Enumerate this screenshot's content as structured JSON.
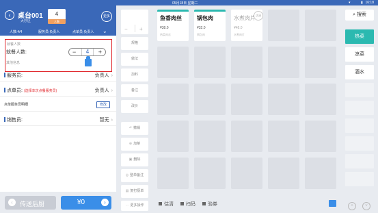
{
  "status_bar": {
    "date": "05月18日 星期二",
    "time": "16:18"
  },
  "header": {
    "table_name": "桌台001",
    "hall": "大厅区",
    "guest_count": "4",
    "guest_label": "人数",
    "more_label": "更多",
    "diners_info": "人数:4/4",
    "waiter_info": "服务员:负责人",
    "orderer_info": "点单员:负责人"
  },
  "form": {
    "diners_section": "就餐人数",
    "diners_label": "就餐人数:",
    "diners_value": "4",
    "other_info": "其他信息",
    "waiter_label": "服务员:",
    "waiter_value": "负责人",
    "orderer_label": "点单员:",
    "orderer_note": "(选择本次点餐服务员)",
    "orderer_value": "负责人",
    "per_order_label": "点单服务员明细",
    "modify_label": "修改",
    "sales_label": "销售员:",
    "sales_value": "暂无"
  },
  "footer": {
    "send_label": "传送后厨",
    "total": "¥0"
  },
  "actions": [
    "规格",
    "做法",
    "加料",
    "备注",
    "改价",
    "撤销",
    "加菜",
    "删除",
    "整单备注",
    "复打厨单",
    "更多操作"
  ],
  "dishes": [
    {
      "name": "鱼香肉丝",
      "price": "¥38.0",
      "category": "热菜肉丝",
      "available": true
    },
    {
      "name": "锅包肉",
      "price": "¥32.0",
      "category": "锅包肉",
      "available": true
    },
    {
      "name": "水煮肉片",
      "price": "¥48.0",
      "category": "水煮肉片",
      "available": false,
      "badge": "沽清"
    }
  ],
  "bottom_bar": {
    "sold_out": "估清",
    "scan": "扫码",
    "coupon": "验券"
  },
  "sidebar": {
    "search_label": "搜索",
    "categories": [
      "热菜",
      "凉菜",
      "酒水"
    ]
  }
}
